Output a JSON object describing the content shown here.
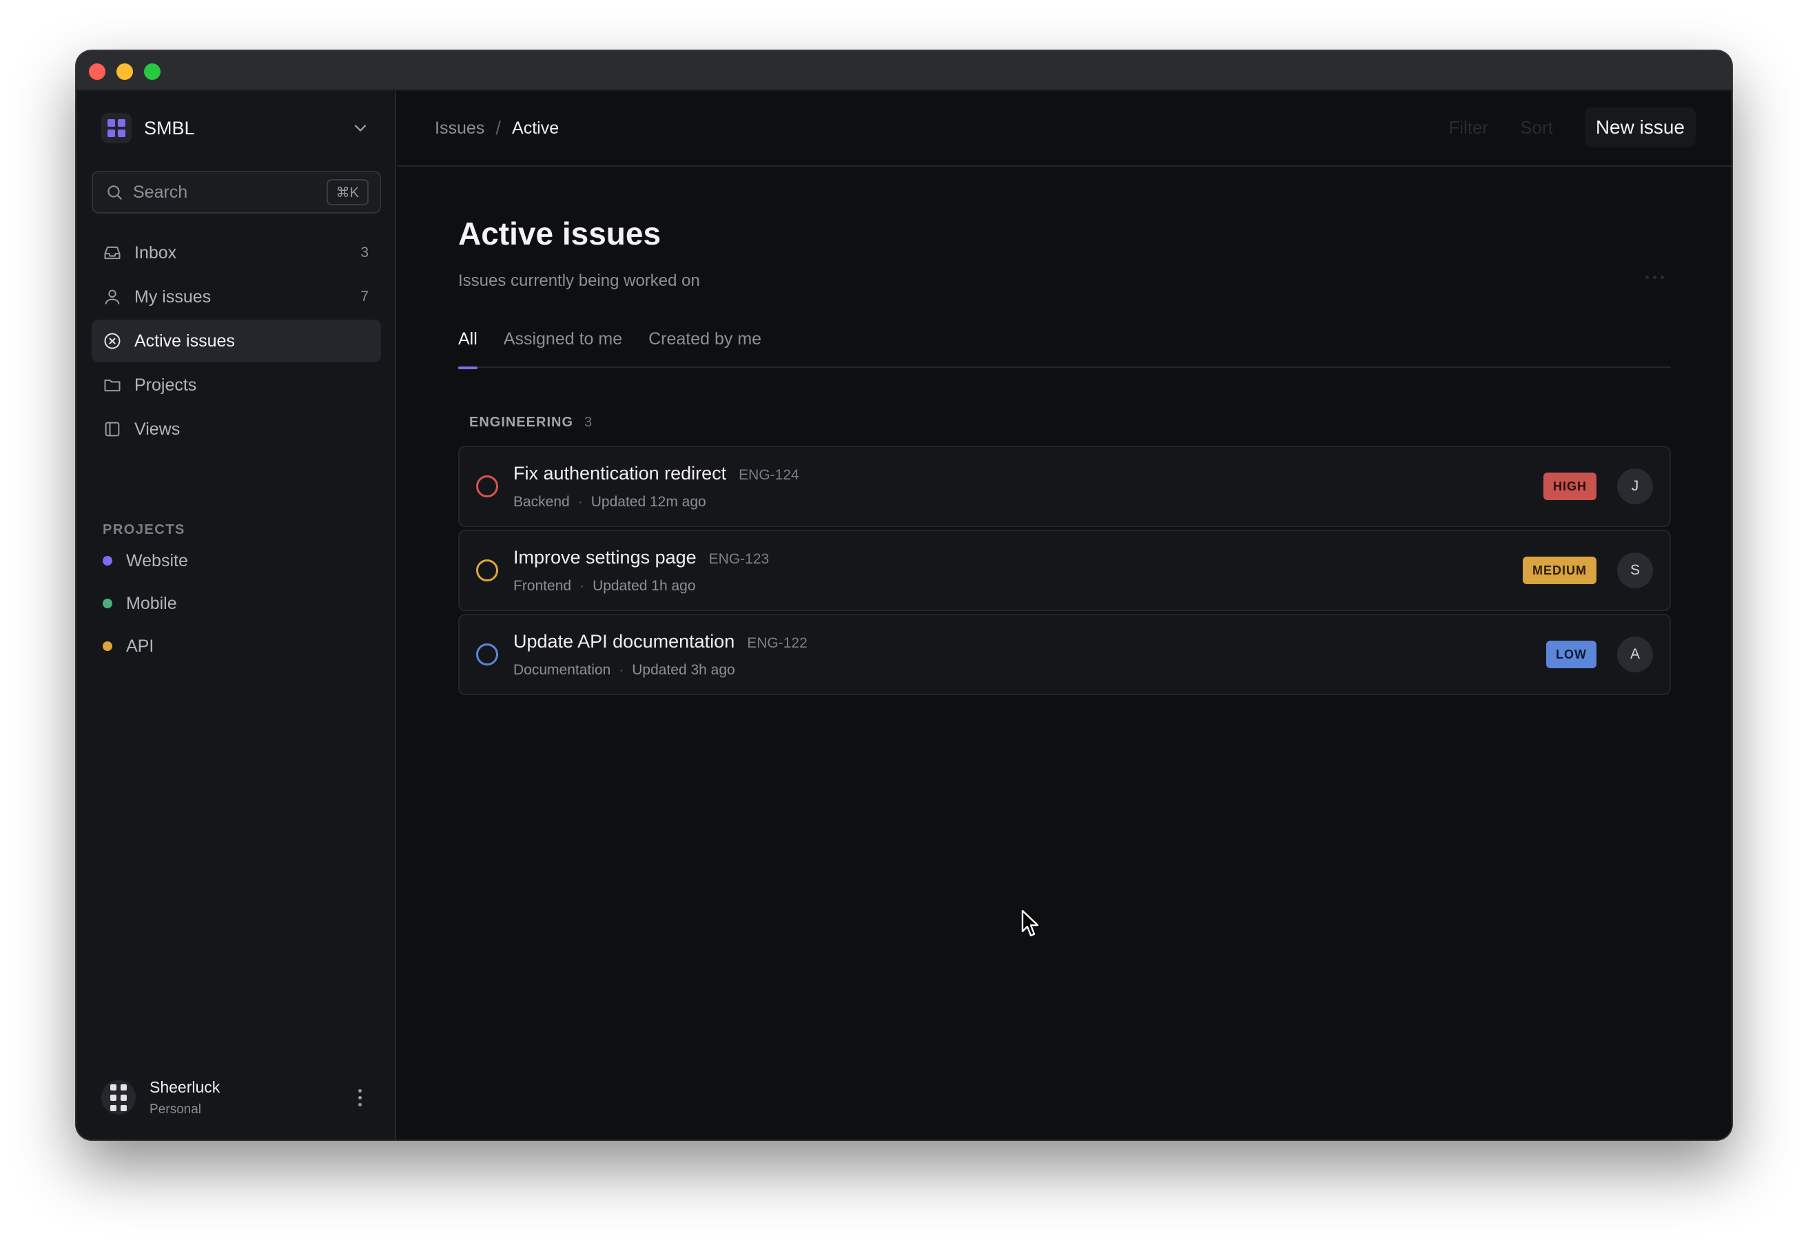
{
  "window": {
    "traffic_lights": [
      "close",
      "minimize",
      "zoom"
    ]
  },
  "sidebar": {
    "workspace": {
      "name": "SMBL",
      "icon": "workspace-grid-icon",
      "accent": "#7b6cf2"
    },
    "search": {
      "placeholder": "Search",
      "shortcut": "⌘K"
    },
    "nav": [
      {
        "label": "Inbox",
        "icon": "inbox-icon",
        "count": "3"
      },
      {
        "label": "My issues",
        "icon": "user-icon",
        "count": "7"
      },
      {
        "label": "Active issues",
        "icon": "circle-x-icon",
        "count": "",
        "active": true
      },
      {
        "label": "Projects",
        "icon": "folder-icon",
        "count": ""
      },
      {
        "label": "Views",
        "icon": "sidebar-layout-icon",
        "count": ""
      }
    ],
    "projects_heading": "PROJECTS",
    "projects": [
      {
        "label": "Website",
        "color": "#7b6cf2"
      },
      {
        "label": "Mobile",
        "color": "#4caf7d"
      },
      {
        "label": "API",
        "color": "#e0a43c"
      }
    ],
    "user": {
      "name": "Sheerluck",
      "plan": "Personal"
    }
  },
  "topbar": {
    "breadcrumb": [
      "Issues",
      "Active"
    ],
    "filter_label": "Filter",
    "sort_label": "Sort",
    "new_issue_label": "New issue"
  },
  "page": {
    "title": "Active issues",
    "subtitle": "Issues currently being worked on",
    "tabs": [
      {
        "label": "All",
        "active": true
      },
      {
        "label": "Assigned to me",
        "active": false
      },
      {
        "label": "Created by me",
        "active": false
      }
    ],
    "group": {
      "name": "ENGINEERING",
      "count": "3"
    },
    "issues": [
      {
        "title": "Fix authentication redirect",
        "key": "ENG-124",
        "component": "Backend",
        "updated": "Updated 12m ago",
        "priority": "HIGH",
        "priority_bg": "#c9544f",
        "priority_fg": "#2a0e0d",
        "status_color": "#d9534f",
        "assignee": "J"
      },
      {
        "title": "Improve settings page",
        "key": "ENG-123",
        "component": "Frontend",
        "updated": "Updated 1h ago",
        "priority": "MEDIUM",
        "priority_bg": "#d9a441",
        "priority_fg": "#2b1f06",
        "status_color": "#e0a43c",
        "assignee": "S"
      },
      {
        "title": "Update API documentation",
        "key": "ENG-122",
        "component": "Documentation",
        "updated": "Updated 3h ago",
        "priority": "LOW",
        "priority_bg": "#5b86d9",
        "priority_fg": "#0c1a33",
        "status_color": "#5b86d9",
        "assignee": "A"
      }
    ]
  }
}
